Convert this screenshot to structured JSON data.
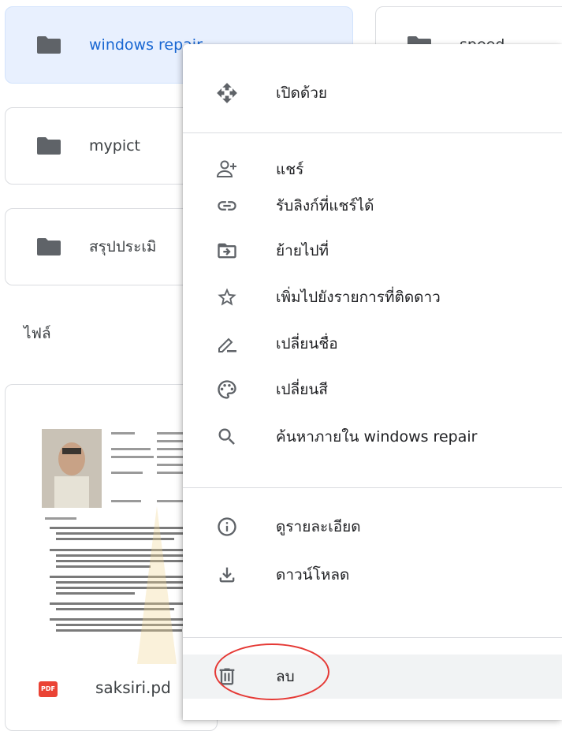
{
  "folders": [
    {
      "name": "windows repair",
      "icon": "folder-icon",
      "selected": true
    },
    {
      "name": "mypict",
      "icon": "folder-icon"
    },
    {
      "name": "สรุปประเมิ",
      "icon": "folder-icon"
    },
    {
      "name": "speed",
      "icon": "folder-icon"
    }
  ],
  "files_section": {
    "title": "ไฟล์"
  },
  "file": {
    "name": "saksiri.pd",
    "type_badge": "PDF",
    "icon": "pdf-icon"
  },
  "context_menu": {
    "items": [
      {
        "label": "เปิดด้วย",
        "icon": "open-with-icon"
      },
      {
        "label": "แชร์",
        "icon": "share-person-add-icon"
      },
      {
        "label": "รับลิงก์ที่แชร์ได้",
        "icon": "link-icon"
      },
      {
        "label": "ย้ายไปที่",
        "icon": "move-to-folder-icon"
      },
      {
        "label": "เพิ่มไปยังรายการที่ติดดาว",
        "icon": "star-icon"
      },
      {
        "label": "เปลี่ยนชื่อ",
        "icon": "rename-pencil-icon"
      },
      {
        "label": "เปลี่ยนสี",
        "icon": "palette-icon"
      },
      {
        "label": "ค้นหาภายใน windows repair",
        "icon": "search-icon"
      },
      {
        "label": "ดูรายละเอียด",
        "icon": "info-icon"
      },
      {
        "label": "ดาวน์โหลด",
        "icon": "download-icon"
      },
      {
        "label": "ลบ",
        "icon": "trash-icon",
        "highlighted": true
      }
    ]
  },
  "colors": {
    "accent": "#1967d2",
    "selected_bg": "#e8f0fe",
    "pdf": "#ea4335",
    "annotation": "#e53935"
  }
}
